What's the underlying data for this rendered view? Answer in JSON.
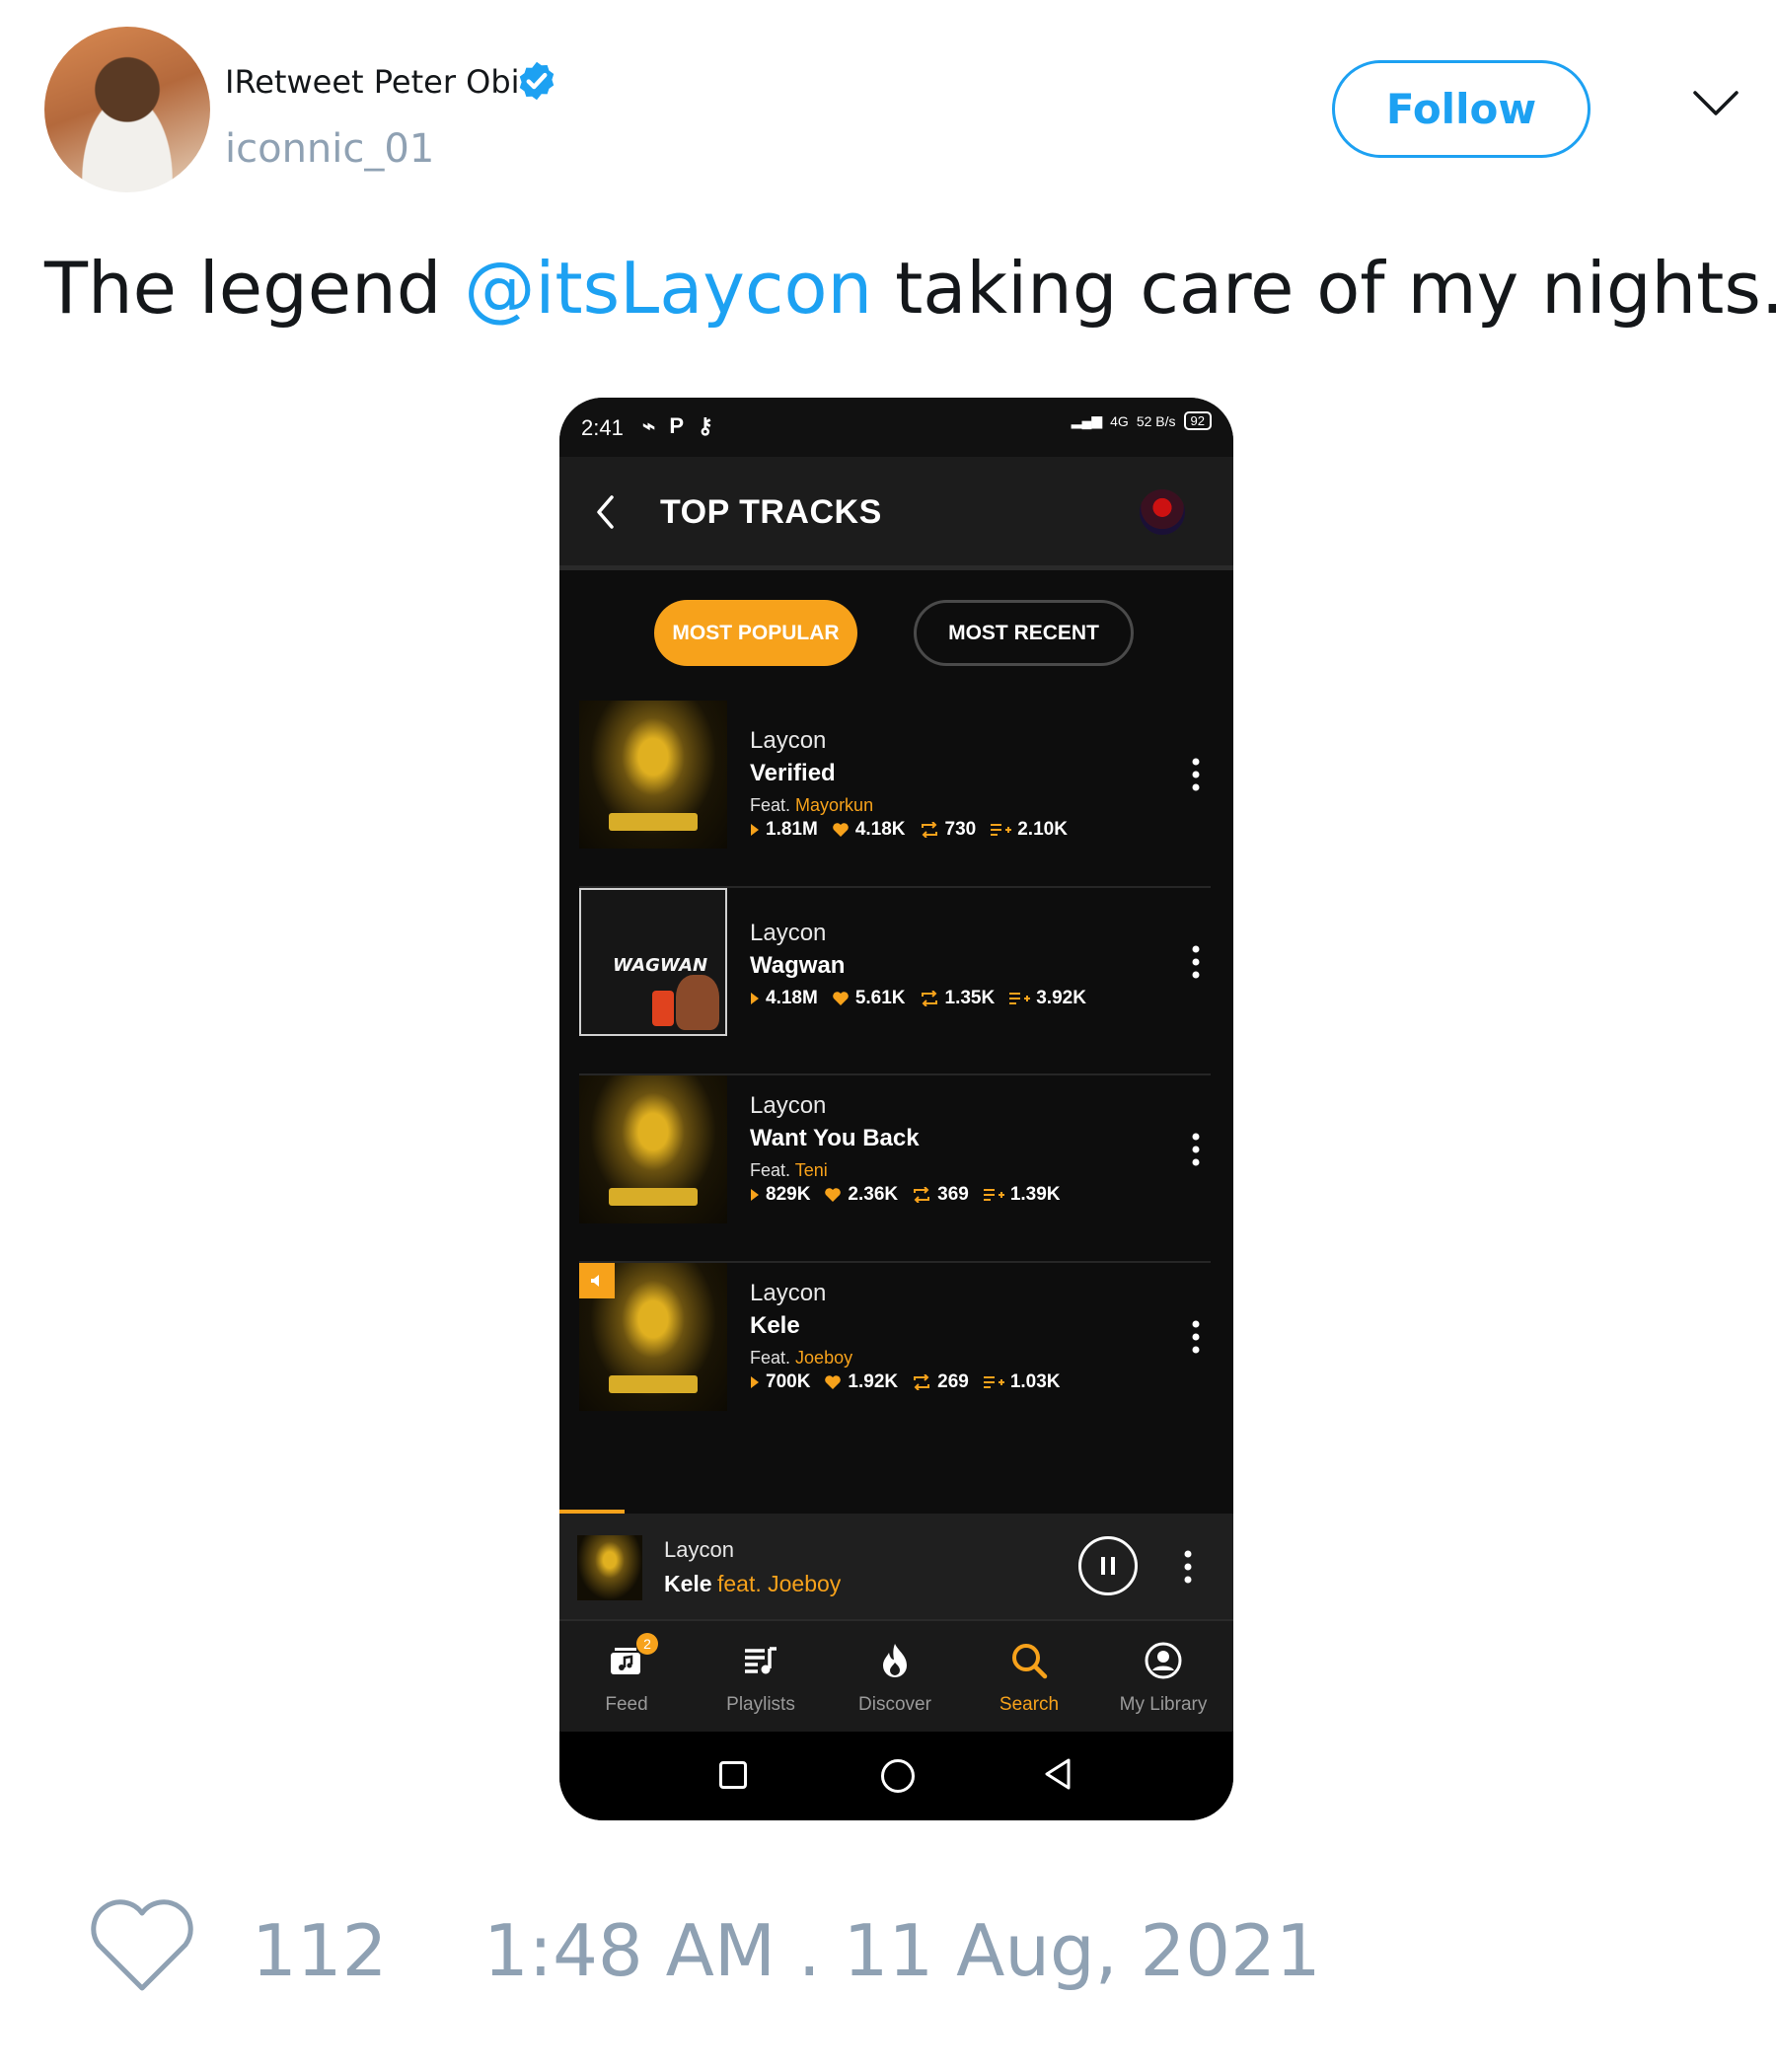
{
  "tweet": {
    "display_name": "IRetweet Peter Obi",
    "handle": "iconnic_01",
    "follow_label": "Follow",
    "text_before": "The legend ",
    "mention": "@itsLaycon",
    "text_after": " taking care of my nights.",
    "like_count": "112",
    "timestamp": "1:48 AM . 11 Aug, 2021",
    "accent_color": "#1da1f2"
  },
  "phone": {
    "status": {
      "time": "2:41",
      "left_icons": "⌁ P ⚷",
      "network": "4G",
      "speed": "52 B/s",
      "battery": "92"
    },
    "app": {
      "title": "TOP TRACKS",
      "accent_color": "#f7a21b",
      "filters": [
        "MOST POPULAR",
        "MOST RECENT"
      ],
      "active_filter": "MOST POPULAR",
      "tracks": [
        {
          "artist": "Laycon",
          "title": "Verified",
          "feat_prefix": "Feat.",
          "feat": "Mayorkun",
          "plays": "1.81M",
          "likes": "4.18K",
          "reposts": "730",
          "playlist_adds": "2.10K"
        },
        {
          "artist": "Laycon",
          "title": "Wagwan",
          "feat_prefix": "",
          "feat": "",
          "plays": "4.18M",
          "likes": "5.61K",
          "reposts": "1.35K",
          "playlist_adds": "3.92K",
          "cover_text": "WAGWAN"
        },
        {
          "artist": "Laycon",
          "title": "Want You Back",
          "feat_prefix": "Feat.",
          "feat": "Teni",
          "plays": "829K",
          "likes": "2.36K",
          "reposts": "369",
          "playlist_adds": "1.39K"
        },
        {
          "artist": "Laycon",
          "title": "Kele",
          "feat_prefix": "Feat.",
          "feat": "Joeboy",
          "plays": "700K",
          "likes": "1.92K",
          "reposts": "269",
          "playlist_adds": "1.03K"
        }
      ],
      "now_playing": {
        "artist": "Laycon",
        "title": "Kele",
        "feat": "feat. Joeboy",
        "state": "playing"
      },
      "nav": [
        {
          "label": "Feed",
          "icon": "music-feed-icon",
          "badge": "2"
        },
        {
          "label": "Playlists",
          "icon": "playlist-icon"
        },
        {
          "label": "Discover",
          "icon": "flame-icon"
        },
        {
          "label": "Search",
          "icon": "search-icon",
          "active": true
        },
        {
          "label": "My Library",
          "icon": "account-icon"
        }
      ]
    }
  }
}
